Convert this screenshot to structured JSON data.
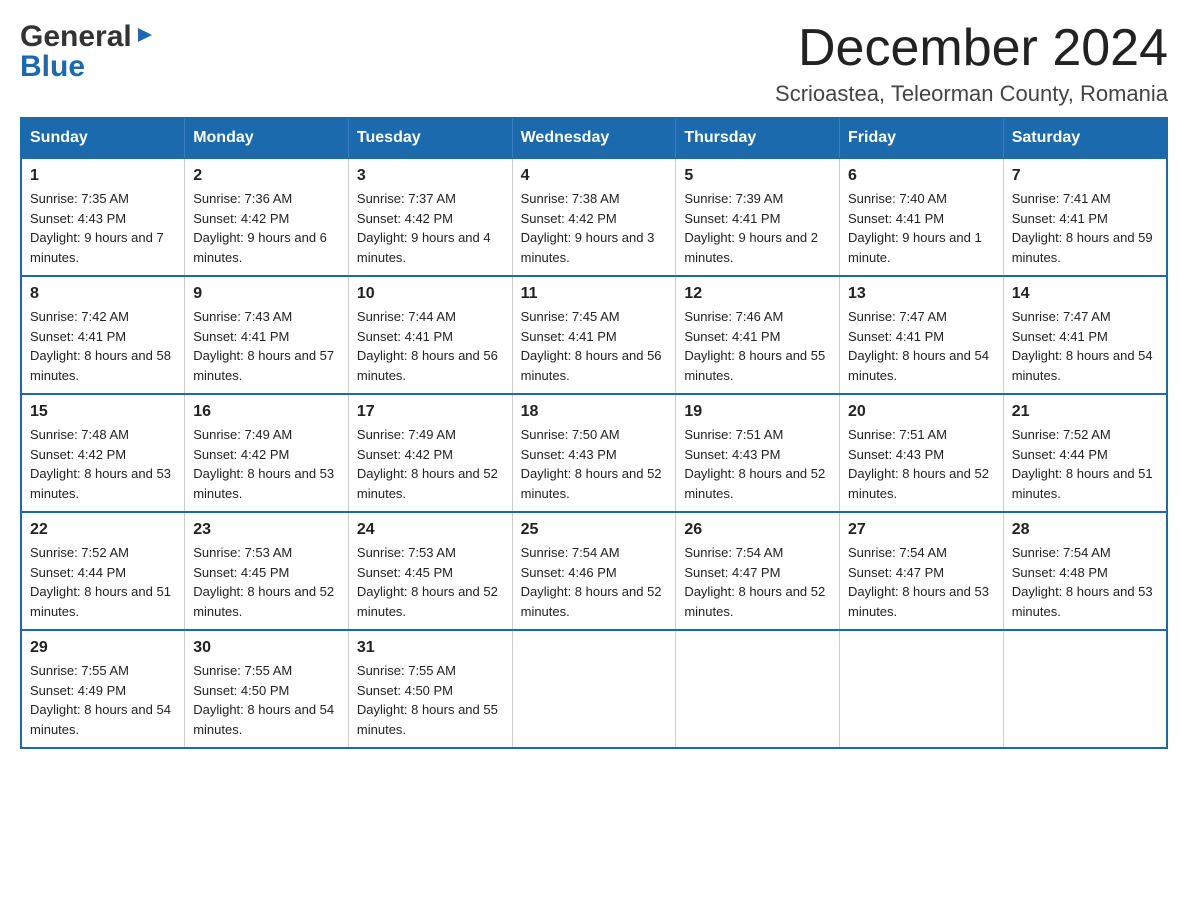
{
  "header": {
    "logo_general": "General",
    "logo_blue": "Blue",
    "main_title": "December 2024",
    "subtitle": "Scrioastea, Teleorman County, Romania"
  },
  "calendar": {
    "days_of_week": [
      "Sunday",
      "Monday",
      "Tuesday",
      "Wednesday",
      "Thursday",
      "Friday",
      "Saturday"
    ],
    "weeks": [
      [
        {
          "day": 1,
          "sunrise": "7:35 AM",
          "sunset": "4:43 PM",
          "daylight": "9 hours and 7 minutes."
        },
        {
          "day": 2,
          "sunrise": "7:36 AM",
          "sunset": "4:42 PM",
          "daylight": "9 hours and 6 minutes."
        },
        {
          "day": 3,
          "sunrise": "7:37 AM",
          "sunset": "4:42 PM",
          "daylight": "9 hours and 4 minutes."
        },
        {
          "day": 4,
          "sunrise": "7:38 AM",
          "sunset": "4:42 PM",
          "daylight": "9 hours and 3 minutes."
        },
        {
          "day": 5,
          "sunrise": "7:39 AM",
          "sunset": "4:41 PM",
          "daylight": "9 hours and 2 minutes."
        },
        {
          "day": 6,
          "sunrise": "7:40 AM",
          "sunset": "4:41 PM",
          "daylight": "9 hours and 1 minute."
        },
        {
          "day": 7,
          "sunrise": "7:41 AM",
          "sunset": "4:41 PM",
          "daylight": "8 hours and 59 minutes."
        }
      ],
      [
        {
          "day": 8,
          "sunrise": "7:42 AM",
          "sunset": "4:41 PM",
          "daylight": "8 hours and 58 minutes."
        },
        {
          "day": 9,
          "sunrise": "7:43 AM",
          "sunset": "4:41 PM",
          "daylight": "8 hours and 57 minutes."
        },
        {
          "day": 10,
          "sunrise": "7:44 AM",
          "sunset": "4:41 PM",
          "daylight": "8 hours and 56 minutes."
        },
        {
          "day": 11,
          "sunrise": "7:45 AM",
          "sunset": "4:41 PM",
          "daylight": "8 hours and 56 minutes."
        },
        {
          "day": 12,
          "sunrise": "7:46 AM",
          "sunset": "4:41 PM",
          "daylight": "8 hours and 55 minutes."
        },
        {
          "day": 13,
          "sunrise": "7:47 AM",
          "sunset": "4:41 PM",
          "daylight": "8 hours and 54 minutes."
        },
        {
          "day": 14,
          "sunrise": "7:47 AM",
          "sunset": "4:41 PM",
          "daylight": "8 hours and 54 minutes."
        }
      ],
      [
        {
          "day": 15,
          "sunrise": "7:48 AM",
          "sunset": "4:42 PM",
          "daylight": "8 hours and 53 minutes."
        },
        {
          "day": 16,
          "sunrise": "7:49 AM",
          "sunset": "4:42 PM",
          "daylight": "8 hours and 53 minutes."
        },
        {
          "day": 17,
          "sunrise": "7:49 AM",
          "sunset": "4:42 PM",
          "daylight": "8 hours and 52 minutes."
        },
        {
          "day": 18,
          "sunrise": "7:50 AM",
          "sunset": "4:43 PM",
          "daylight": "8 hours and 52 minutes."
        },
        {
          "day": 19,
          "sunrise": "7:51 AM",
          "sunset": "4:43 PM",
          "daylight": "8 hours and 52 minutes."
        },
        {
          "day": 20,
          "sunrise": "7:51 AM",
          "sunset": "4:43 PM",
          "daylight": "8 hours and 52 minutes."
        },
        {
          "day": 21,
          "sunrise": "7:52 AM",
          "sunset": "4:44 PM",
          "daylight": "8 hours and 51 minutes."
        }
      ],
      [
        {
          "day": 22,
          "sunrise": "7:52 AM",
          "sunset": "4:44 PM",
          "daylight": "8 hours and 51 minutes."
        },
        {
          "day": 23,
          "sunrise": "7:53 AM",
          "sunset": "4:45 PM",
          "daylight": "8 hours and 52 minutes."
        },
        {
          "day": 24,
          "sunrise": "7:53 AM",
          "sunset": "4:45 PM",
          "daylight": "8 hours and 52 minutes."
        },
        {
          "day": 25,
          "sunrise": "7:54 AM",
          "sunset": "4:46 PM",
          "daylight": "8 hours and 52 minutes."
        },
        {
          "day": 26,
          "sunrise": "7:54 AM",
          "sunset": "4:47 PM",
          "daylight": "8 hours and 52 minutes."
        },
        {
          "day": 27,
          "sunrise": "7:54 AM",
          "sunset": "4:47 PM",
          "daylight": "8 hours and 53 minutes."
        },
        {
          "day": 28,
          "sunrise": "7:54 AM",
          "sunset": "4:48 PM",
          "daylight": "8 hours and 53 minutes."
        }
      ],
      [
        {
          "day": 29,
          "sunrise": "7:55 AM",
          "sunset": "4:49 PM",
          "daylight": "8 hours and 54 minutes."
        },
        {
          "day": 30,
          "sunrise": "7:55 AM",
          "sunset": "4:50 PM",
          "daylight": "8 hours and 54 minutes."
        },
        {
          "day": 31,
          "sunrise": "7:55 AM",
          "sunset": "4:50 PM",
          "daylight": "8 hours and 55 minutes."
        },
        null,
        null,
        null,
        null
      ]
    ]
  }
}
